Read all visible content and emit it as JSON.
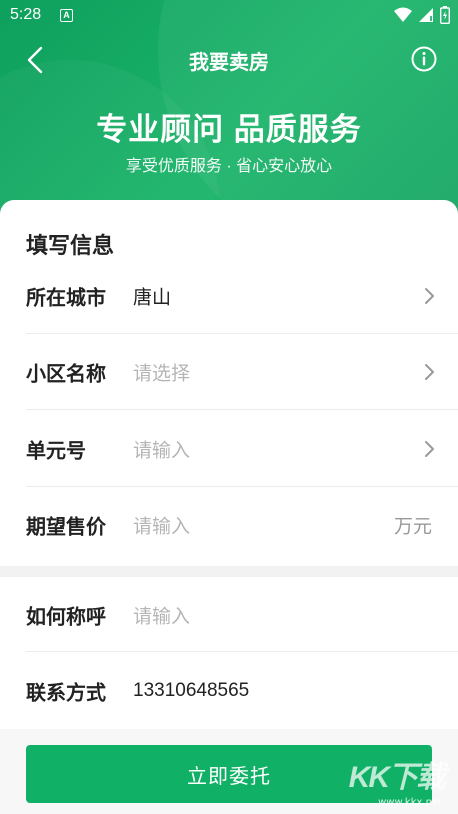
{
  "status": {
    "time": "5:28",
    "notification_icon": "A"
  },
  "nav": {
    "title": "我要卖房",
    "back_icon": "chevron-left-icon",
    "info_icon": "info-icon"
  },
  "hero": {
    "slogan": "专业顾问 品质服务",
    "subslogan": "享受优质服务 · 省心安心放心"
  },
  "form": {
    "section_title": "填写信息",
    "city": {
      "label": "所在城市",
      "value": "唐山"
    },
    "community": {
      "label": "小区名称",
      "placeholder": "请选择"
    },
    "unit": {
      "label": "单元号",
      "placeholder": "请输入"
    },
    "price": {
      "label": "期望售价",
      "placeholder": "请输入",
      "unit": "万元"
    },
    "name": {
      "label": "如何称呼",
      "placeholder": "请输入"
    },
    "contact": {
      "label": "联系方式",
      "value": "13310648565"
    }
  },
  "submit": {
    "label": "立即委托"
  },
  "watermark": {
    "logo": "KK下载",
    "url": "www.kkx.net"
  },
  "colors": {
    "primary": "#10b066",
    "hero": "#0e9f5d"
  }
}
